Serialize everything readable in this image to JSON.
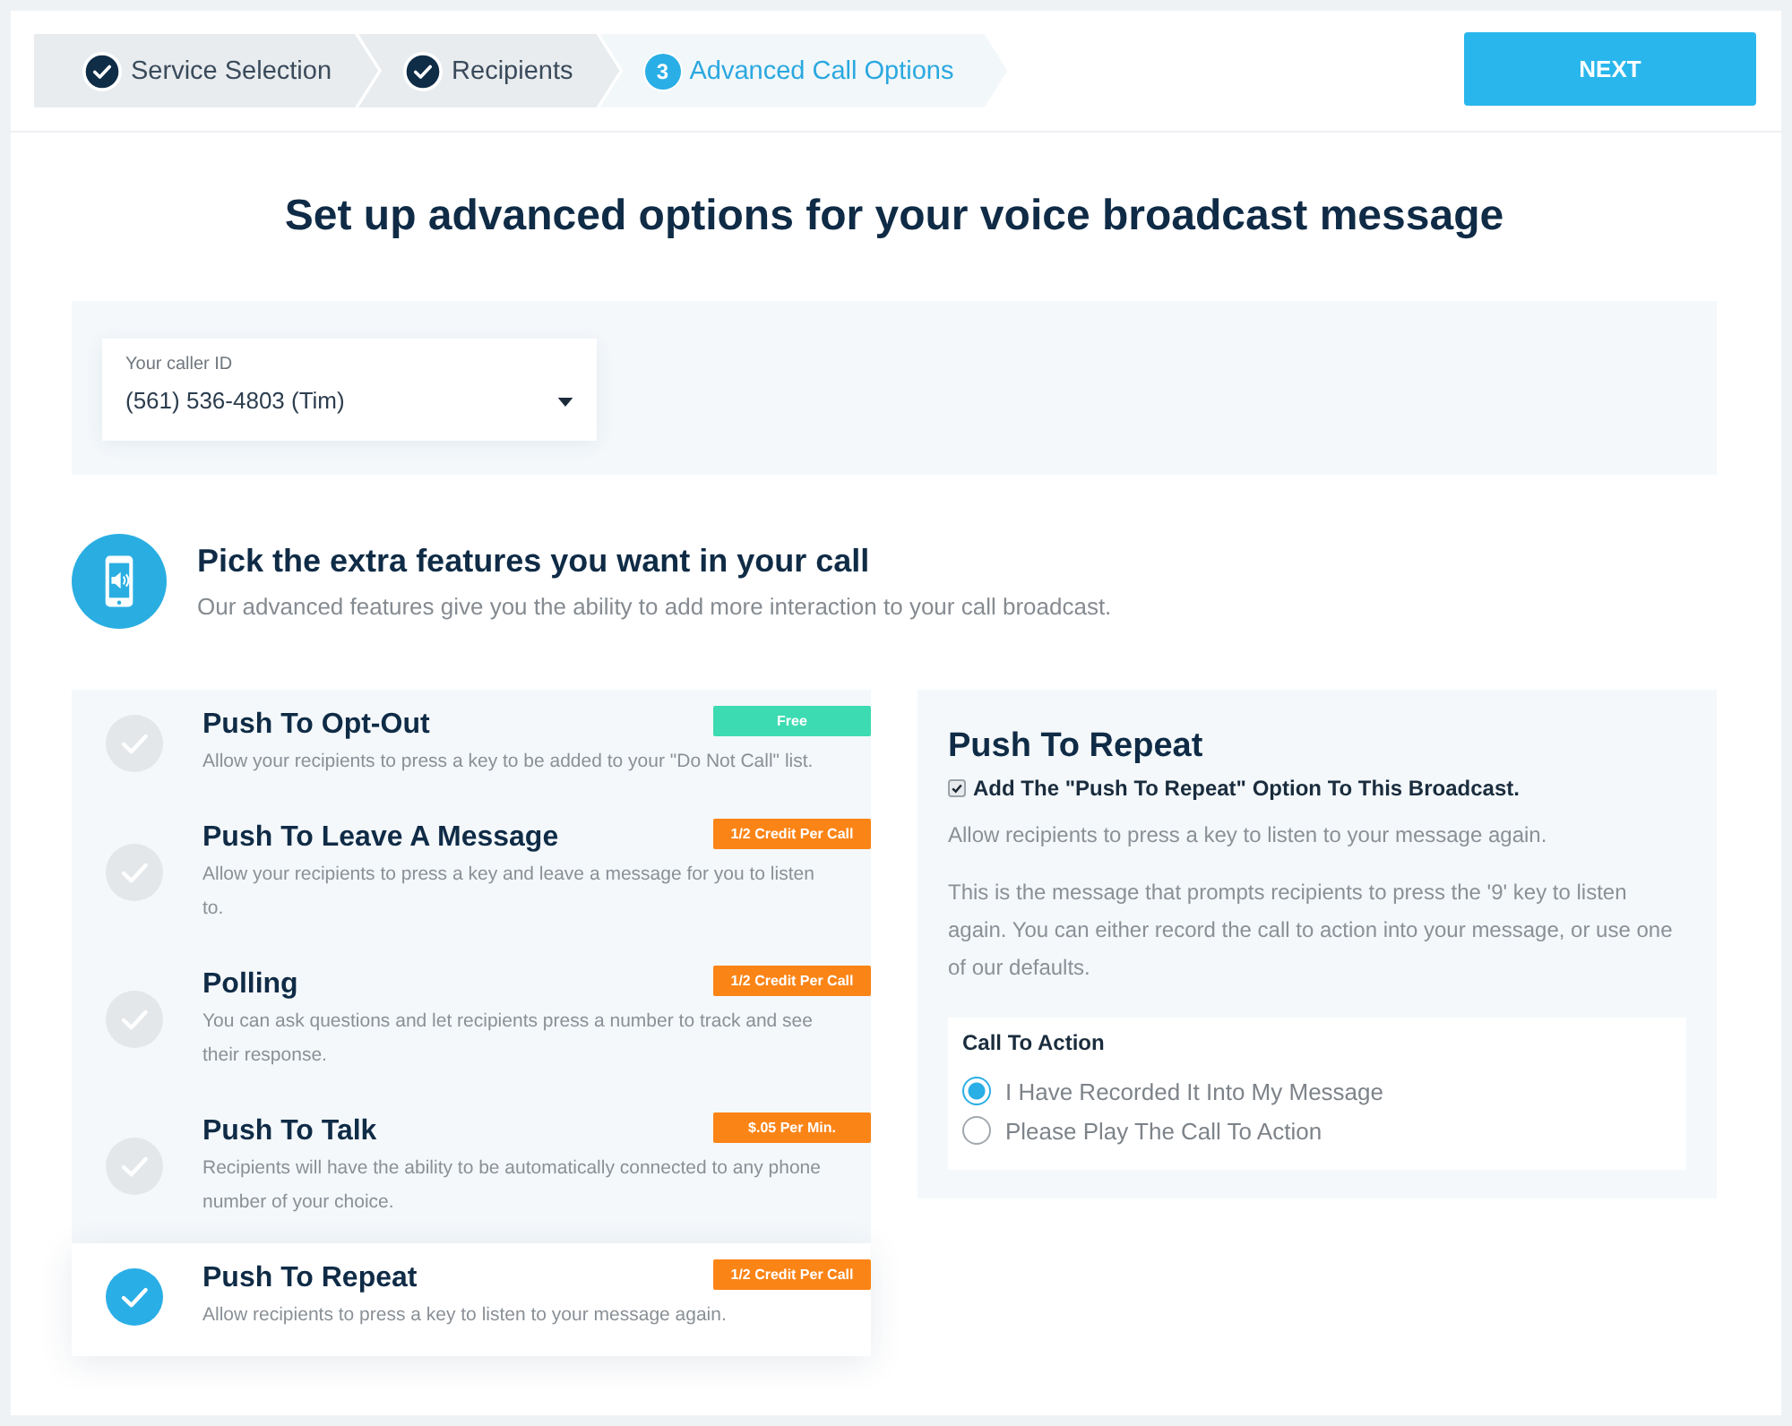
{
  "steps": [
    {
      "label": "Service Selection",
      "completed": true,
      "selected": false
    },
    {
      "label": "Recipients",
      "completed": true,
      "selected": false
    },
    {
      "number": "3",
      "label": "Advanced Call Options",
      "completed": false,
      "selected": true
    }
  ],
  "next_button": {
    "label": "NEXT"
  },
  "title": "Set up advanced options for your voice broadcast message",
  "caller_id": {
    "label": "Your caller ID",
    "value": "(561) 536-4803 (Tim)"
  },
  "features_intro": {
    "title": "Pick the extra features you want in your call",
    "subtitle": "Our advanced features give you the ability to add more interaction to your call broadcast."
  },
  "features": [
    {
      "title": "Push To Opt-Out",
      "description": "Allow your recipients to press a key to be added to your \"Do Not Call\" list.",
      "badge": {
        "text": "Free",
        "color": "#3ddbb2"
      },
      "selected": false
    },
    {
      "title": "Push To Leave A Message",
      "description": "Allow your recipients to press a key and leave a message for you to listen to.",
      "badge": {
        "text": "1/2 Credit Per Call",
        "color": "#fb8416"
      },
      "selected": false
    },
    {
      "title": "Polling",
      "description": "You can ask questions and let recipients press a number to track and see their response.",
      "badge": {
        "text": "1/2 Credit Per Call",
        "color": "#fb8416"
      },
      "selected": false
    },
    {
      "title": "Push To Talk",
      "description": "Recipients will have the ability to be automatically connected to any phone number of your choice.",
      "badge": {
        "text": "$.05 Per Min.",
        "color": "#fb8416"
      },
      "selected": false
    },
    {
      "title": "Push To Repeat",
      "description": "Allow recipients to press a key to listen to your message again.",
      "badge": {
        "text": "1/2 Credit Per Call",
        "color": "#fb8416"
      },
      "selected": true
    }
  ],
  "detail": {
    "title": "Push To Repeat",
    "checkbox": {
      "label": "Add The \"Push To Repeat\" Option To This Broadcast.",
      "checked": true
    },
    "description": "Allow recipients to press a key to listen to your message again.",
    "note": "This is the message that prompts recipients to press the '9' key to listen again. You can either record the call to action into your message, or use one of our defaults.",
    "call_to_action": {
      "title": "Call To Action",
      "options": [
        {
          "label": "I Have Recorded It Into My Message",
          "selected": true
        },
        {
          "label": "Please Play The Call To Action",
          "selected": false
        }
      ]
    }
  }
}
